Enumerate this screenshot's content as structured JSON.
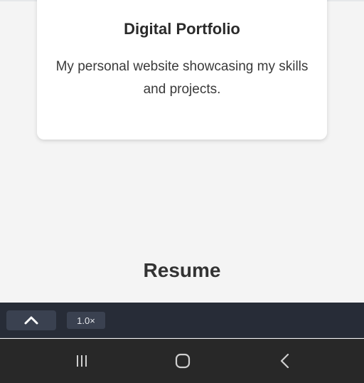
{
  "card": {
    "title": "Digital Portfolio",
    "description": "My personal website showcasing my skills and projects."
  },
  "resume_section": {
    "heading": "Resume"
  },
  "player_bar": {
    "collapse_icon": "chevron-up-icon",
    "speed_label": "1.0×"
  },
  "nav_bar": {
    "recent_icon": "recent-apps-icon",
    "home_icon": "home-icon",
    "back_icon": "back-icon"
  },
  "colors": {
    "background": "#f4f4f4",
    "card": "#ffffff",
    "player_bar": "#272c37",
    "nav_bar": "#282828"
  }
}
